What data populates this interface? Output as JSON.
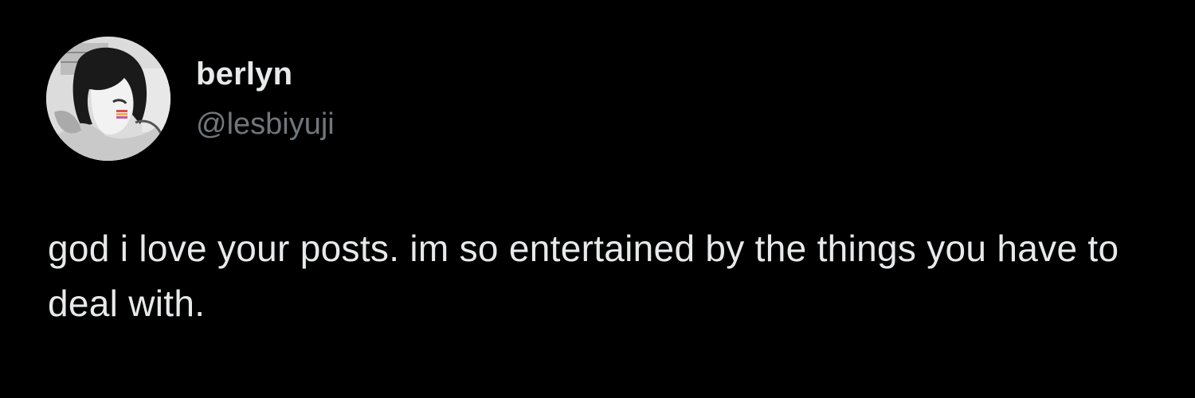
{
  "tweet": {
    "author": {
      "display_name": "berlyn",
      "handle": "@lesbiyuji",
      "avatar_icon": "avatar-image"
    },
    "text": "god i love your posts. im so entertained by the things you have to deal with."
  },
  "colors": {
    "background": "#000000",
    "primary_text": "#e7e9ea",
    "secondary_text": "#71767b"
  }
}
